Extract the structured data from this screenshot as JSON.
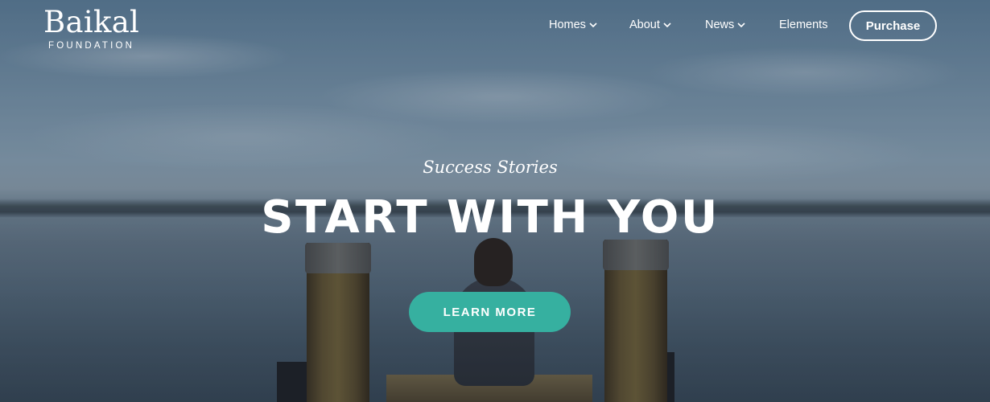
{
  "brand": {
    "name": "Baikal",
    "tagline": "FOUNDATION"
  },
  "nav": {
    "items": [
      {
        "label": "Homes",
        "dropdown": true
      },
      {
        "label": "About",
        "dropdown": true
      },
      {
        "label": "News",
        "dropdown": true
      },
      {
        "label": "Elements",
        "dropdown": false
      }
    ],
    "cta_label": "Purchase"
  },
  "hero": {
    "subtitle": "Success Stories",
    "headline": "START WITH YOU",
    "button_label": "LEARN MORE"
  },
  "colors": {
    "accent": "#36b0a0",
    "text": "#ffffff"
  }
}
